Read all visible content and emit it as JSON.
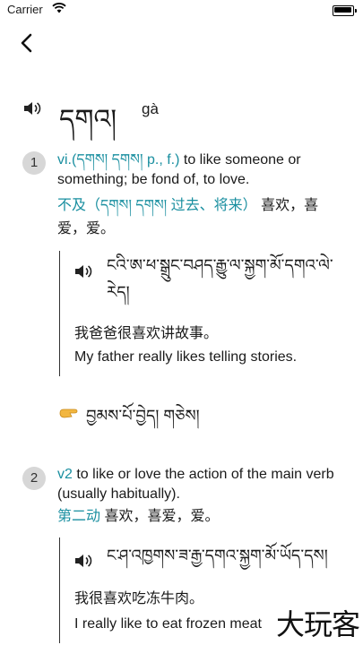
{
  "status_bar": {
    "carrier": "Carrier"
  },
  "entry": {
    "headword": "དགའ།",
    "romanization": "gà"
  },
  "senses": [
    {
      "number": "1",
      "pos": "vi.(དགས། དགས། p., f.)",
      "definition_en": "to like someone or something; be fond of, to love.",
      "pos_zh": "不及（དགས། དགས། 过去、将来）",
      "definition_zh": "喜欢，喜爱，爱。",
      "example": {
        "tibetan": "ངའི་ཨ་ཕ་སྒྲུང་བཤད་རྒྱུ་ལ་སྐྱག་མོ་དགའ་ལེ་རེད།",
        "chinese": "我爸爸很喜欢讲故事。",
        "english": "My father really likes telling stories."
      }
    },
    {
      "number": "2",
      "pos": "v2",
      "definition_en": "to like or love the action of the main verb (usually habitually).",
      "pos_zh": "第二动",
      "definition_zh": "喜欢，喜爱，爱。",
      "example": {
        "tibetan": "ང་ཤ་འཁྱགས་ཟ་རྒྱ་དགའ་སྐྱག་མོ་ཡོད་དས།",
        "chinese": "我很喜欢吃冻牛肉。",
        "english": "I really like to eat frozen meat"
      }
    }
  ],
  "related": {
    "text": "བྱམས་པོ་བྱེད། གཅེས།"
  },
  "watermark": "大玩客"
}
